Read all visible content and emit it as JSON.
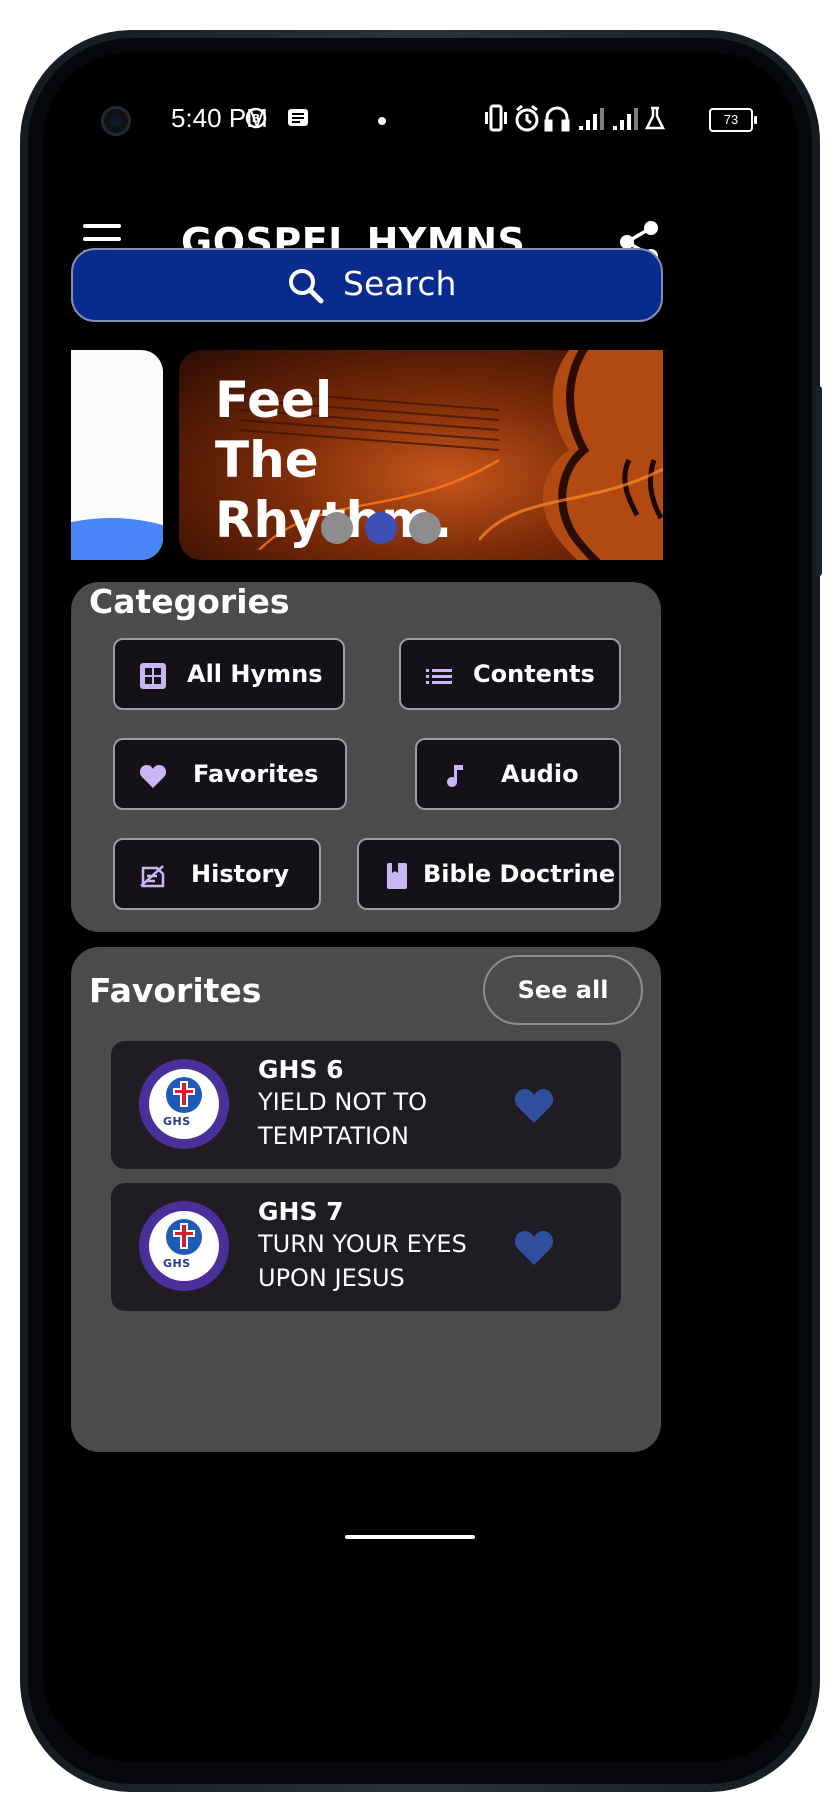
{
  "status_bar": {
    "time": "5:40 PM",
    "battery": "73"
  },
  "app_bar": {
    "title": "GOSPEL HYMNS",
    "menu_icon": "hamburger-menu-icon",
    "share_icon": "share-icon"
  },
  "search": {
    "label": "Search",
    "icon": "search-icon",
    "color": "#0a2b8e"
  },
  "carousel": {
    "slide_text_lines": [
      "Feel",
      "The",
      "Rhythm."
    ],
    "active_index": 1,
    "count": 3,
    "active_color": "#3f4fb8",
    "inactive_color": "#8d8d8d"
  },
  "categories": {
    "title": "Categories",
    "items": [
      {
        "label": "All Hymns",
        "icon": "grid-icon"
      },
      {
        "label": "Contents",
        "icon": "list-icon"
      },
      {
        "label": "Favorites",
        "icon": "heart-icon"
      },
      {
        "label": "Audio",
        "icon": "music-note-icon"
      },
      {
        "label": "History",
        "icon": "history-icon"
      },
      {
        "label": "Bible Doctrine",
        "icon": "book-icon"
      }
    ],
    "icon_color": "#c9b6f5"
  },
  "favorites": {
    "title": "Favorites",
    "see_all": "See all",
    "items": [
      {
        "number": "GHS 6",
        "title": "YIELD NOT TO TEMPTATION",
        "logo_text": "GHS"
      },
      {
        "number": "GHS 7",
        "title": "TURN YOUR EYES UPON JESUS",
        "logo_text": "GHS"
      }
    ],
    "heart_color": "#2f4f9e"
  }
}
